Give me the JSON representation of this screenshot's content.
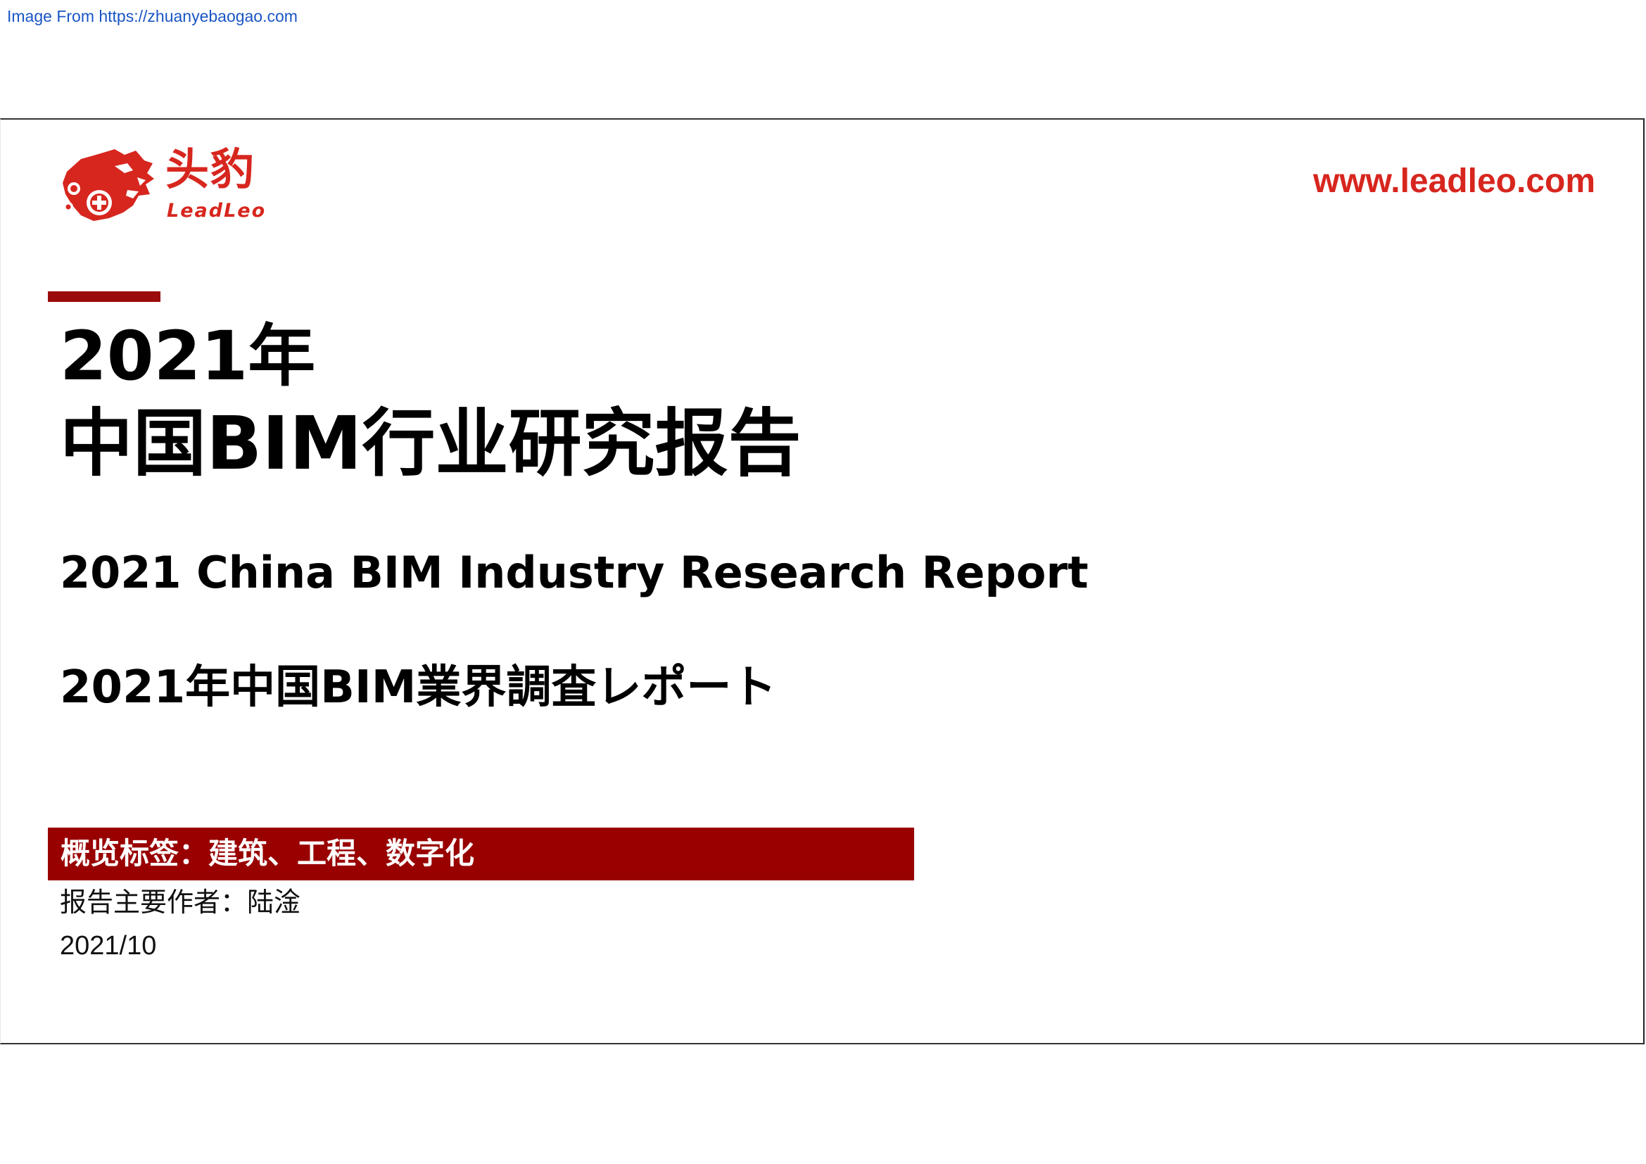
{
  "source_link": "Image From https://zhuanyebaogao.com",
  "logo": {
    "icon": "leopard-head-logo-icon",
    "cn": "头豹",
    "en": "LeadLeo",
    "color": "#d7261e"
  },
  "website": "www.leadleo.com",
  "accent_color": "#9b0b0b",
  "title": {
    "year": "2021年",
    "main": "中国BIM行业研究报告"
  },
  "subtitle_en": "2021 China BIM Industry Research Report",
  "subtitle_jp": "2021年中国BIM業界調査レポート",
  "tags": {
    "text": "概览标签：建筑、工程、数字化",
    "band_color": "#990000"
  },
  "author": "报告主要作者：陆淦",
  "date": "2021/10"
}
